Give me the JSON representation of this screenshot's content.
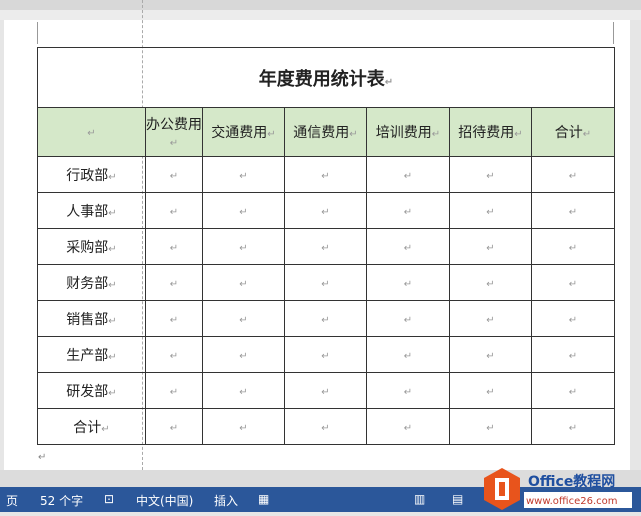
{
  "table": {
    "title": "年度费用统计表",
    "headers": [
      "",
      "办公费用",
      "交通费用",
      "通信费用",
      "培训费用",
      "招待费用",
      "合计"
    ],
    "rows": [
      "行政部",
      "人事部",
      "采购部",
      "财务部",
      "销售部",
      "生产部",
      "研发部",
      "合计"
    ]
  },
  "status": {
    "page": "页",
    "word_count": "52 个字",
    "language": "中文(中国)",
    "mode": "插入"
  },
  "watermark": {
    "name": "Office教程网",
    "url": "www.office26.com"
  },
  "colors": {
    "header_fill": "#d5e8c9",
    "statusbar": "#2b579a"
  }
}
